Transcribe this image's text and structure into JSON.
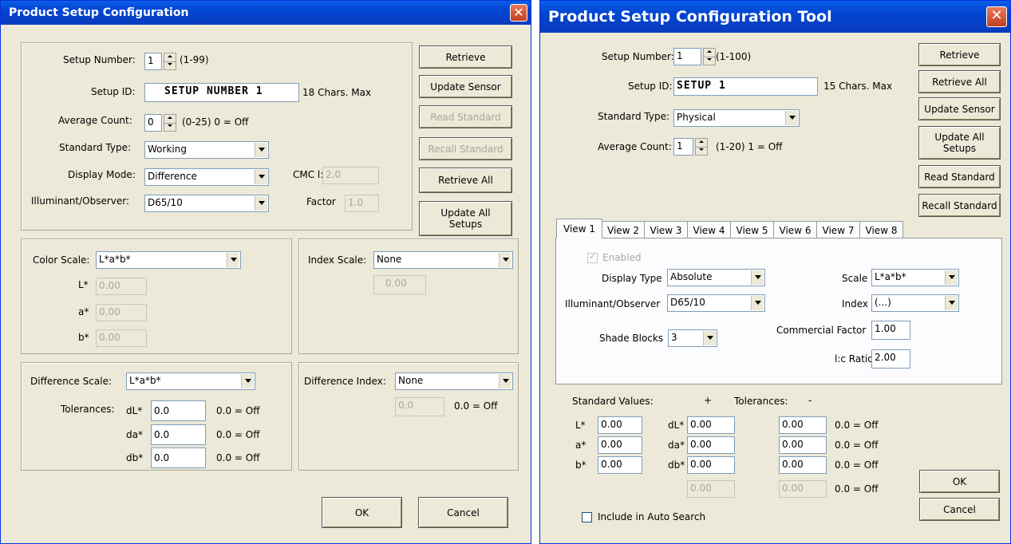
{
  "left": {
    "title": "Product Setup Configuration",
    "setup_number_label": "Setup Number:",
    "setup_number_value": "1",
    "setup_number_range": "(1-99)",
    "setup_id_label": "Setup ID:",
    "setup_id_value": "SETUP NUMBER  1",
    "setup_id_hint": "18 Chars. Max",
    "average_count_label": "Average Count:",
    "average_count_value": "0",
    "average_count_hint": "(0-25) 0 = Off",
    "standard_type_label": "Standard Type:",
    "standard_type_value": "Working",
    "display_mode_label": "Display Mode:",
    "display_mode_value": "Difference",
    "illuminant_label": "Illuminant/Observer:",
    "illuminant_value": "D65/10",
    "cmc_label": "CMC l:c",
    "cmc_value": "2.0",
    "factor_label": "Factor",
    "factor_value": "1.0",
    "buttons": {
      "retrieve": "Retrieve",
      "update_sensor": "Update Sensor",
      "read_standard": "Read Standard",
      "recall_standard": "Recall Standard",
      "retrieve_all": "Retrieve All",
      "update_all_setups": "Update All Setups",
      "ok": "OK",
      "cancel": "Cancel"
    },
    "color_scale_label": "Color Scale:",
    "color_scale_value": "L*a*b*",
    "l_label": "L*",
    "l_value": "0.00",
    "a_label": "a*",
    "a_value": "0.00",
    "b_label": "b*",
    "b_value": "0.00",
    "index_scale_label": "Index Scale:",
    "index_scale_value": "None",
    "index_value": "0.00",
    "difference_scale_label": "Difference Scale:",
    "difference_scale_value": "L*a*b*",
    "tolerances_label": "Tolerances:",
    "dl_label": "dL*",
    "dl_value": "0.0",
    "da_label": "da*",
    "da_value": "0.0",
    "db_label": "db*",
    "db_value": "0.0",
    "off_hint": "0.0 = Off",
    "difference_index_label": "Difference Index:",
    "difference_index_value": "None",
    "difference_index_num": "0.0"
  },
  "right": {
    "title": "Product Setup Configuration Tool",
    "setup_number_label": "Setup Number:",
    "setup_number_value": "1",
    "setup_number_range": "(1-100)",
    "setup_id_label": "Setup ID:",
    "setup_id_value": "SETUP 1",
    "setup_id_hint": "15 Chars. Max",
    "standard_type_label": "Standard Type:",
    "standard_type_value": "Physical",
    "average_count_label": "Average Count:",
    "average_count_value": "1",
    "average_count_hint": "(1-20) 1 = Off",
    "buttons": {
      "retrieve": "Retrieve",
      "retrieve_all": "Retrieve All",
      "update_sensor": "Update Sensor",
      "update_all_setups": "Update All Setups",
      "read_standard": "Read Standard",
      "recall_standard": "Recall Standard",
      "ok": "OK",
      "cancel": "Cancel"
    },
    "tabs": [
      "View 1",
      "View 2",
      "View 3",
      "View 4",
      "View 5",
      "View 6",
      "View 7",
      "View 8"
    ],
    "enabled_label": "Enabled",
    "display_type_label": "Display Type",
    "display_type_value": "Absolute",
    "scale_label": "Scale",
    "scale_value": "L*a*b*",
    "illuminant_label": "Illuminant/Observer",
    "illuminant_value": "D65/10",
    "index_label": "Index",
    "index_value": "(...)",
    "shade_blocks_label": "Shade Blocks",
    "shade_blocks_value": "3",
    "commercial_factor_label": "Commercial Factor",
    "commercial_factor_value": "1.00",
    "lc_ratio_label": "l:c Ratio",
    "lc_ratio_value": "2.00",
    "standard_values_label": "Standard Values:",
    "plus_label": "+",
    "tolerances_label": "Tolerances:",
    "minus_label": "-",
    "l_label": "L*",
    "l_value": "0.00",
    "a_label": "a*",
    "a_value": "0.00",
    "b_label": "b*",
    "b_value": "0.00",
    "dl_label": "dL*",
    "dl_value": "0.00",
    "da_label": "da*",
    "da_value": "0.00",
    "db_label": "db*",
    "db_value": "0.00",
    "extra_plus_value": "0.00",
    "minus_l_value": "0.00",
    "minus_a_value": "0.00",
    "minus_b_value": "0.00",
    "minus_extra_value": "0.00",
    "off_hint": "0.0 = Off",
    "include_auto_search_label": "Include in Auto Search"
  }
}
